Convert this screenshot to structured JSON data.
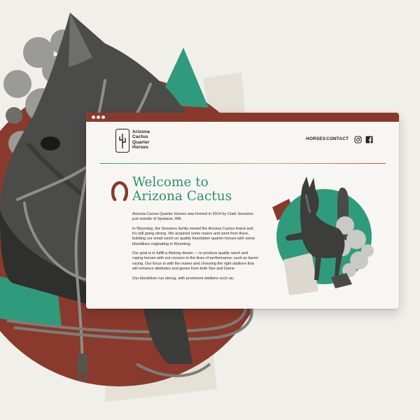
{
  "browser": {
    "titlebar_color": "#8a3a2c"
  },
  "site": {
    "logo": {
      "lines": [
        "Arizona",
        "Cactus",
        "Quarter",
        "Horses"
      ],
      "icon": "cactus-logo-icon"
    },
    "nav": {
      "items": [
        "HORSES",
        "CONTACT"
      ],
      "social": [
        "instagram-icon",
        "facebook-icon"
      ]
    },
    "heading": {
      "line1": "Welcome to",
      "line2": "Arizona Cactus",
      "icon": "horseshoe-icon"
    },
    "paragraphs": [
      "Arizona Cactus Quarter Horses was formed in 2014 by Clark Sessions just outside of Spokane, WA.",
      "In Wyoming, the Sessions family owned the Arizona Cactus brand and it's still going strong. We acquired some mares and went from there, building our small ranch on quality foundation quarter horses with some bloodlines originating in Wyoming.",
      "Our goal is to fulfill a lifelong dream — to produce quality ranch and roping horses with out crosses in the lines of performance; such as barrel racing. Our focus is with the mares and choosing the right stallions that will enhance attributes and genes from both Sire and Dame",
      "Our bloodlines run strong, with prominent stallions such as;"
    ]
  },
  "colors": {
    "rust": "#8a3a2c",
    "teal": "#2e8f73",
    "background": "#f1efea"
  }
}
